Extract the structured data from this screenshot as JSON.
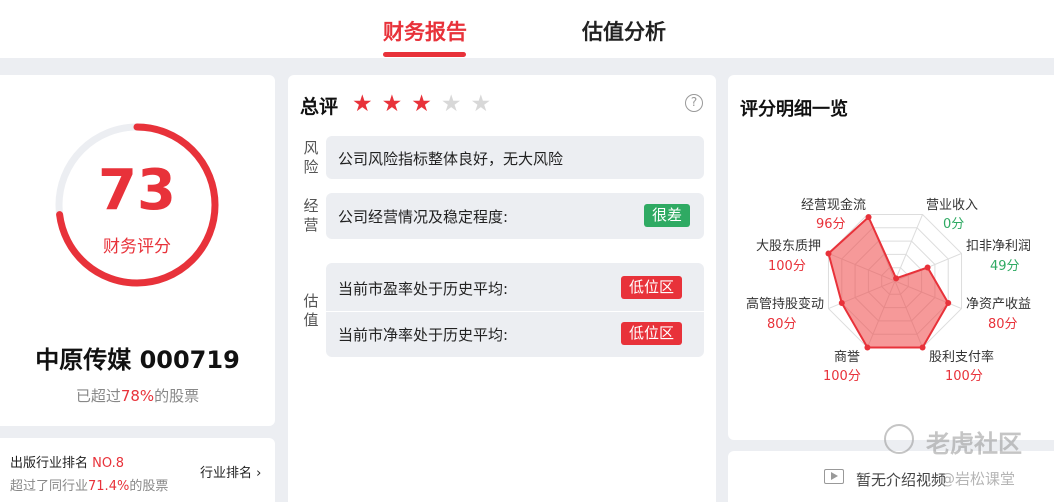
{
  "tabs": {
    "financial_report": "财务报告",
    "valuation": "估值分析"
  },
  "score": {
    "value": 73,
    "max": 100,
    "label": "财务评分"
  },
  "stock": {
    "name": "中原传媒 000719",
    "exceed_prefix": "已超过",
    "exceed_pct": "78%",
    "exceed_suffix": "的股票"
  },
  "industry_rank": {
    "prefix": "出版行业排名 ",
    "rank": "NO.8",
    "exceed_prefix": "超过了同行业",
    "exceed_pct": "71.4%",
    "exceed_suffix": "的股票",
    "link_label": "行业排名",
    "link_chevron": "›"
  },
  "summary": {
    "title": "总评",
    "stars_total": 5,
    "stars_filled": 3,
    "help": "?",
    "risk": {
      "label": "风险",
      "text": "公司风险指标整体良好，无大风险"
    },
    "operation": {
      "label": "经营",
      "text": "公司经营情况及稳定程度:",
      "badge": "很差",
      "badge_color": "#2faa63"
    },
    "valuation": {
      "label": "估值",
      "pe_text": "当前市盈率处于历史平均:",
      "pe_badge": "低位区",
      "pb_text": "当前市净率处于历史平均:",
      "pb_badge": "低位区",
      "badge_color": "#e8323a"
    }
  },
  "detail": {
    "title": "评分明细一览",
    "no_intro": "暂无介绍视频"
  },
  "chart_data": {
    "type": "radar",
    "max": 100,
    "axes": [
      {
        "label": "营业收入",
        "value": 0,
        "display": "0分",
        "color": "green"
      },
      {
        "label": "扣非净利润",
        "value": 49,
        "display": "49分",
        "color": "green"
      },
      {
        "label": "净资产收益",
        "value": 80,
        "display": "80分",
        "color": "red"
      },
      {
        "label": "股利支付率",
        "value": 100,
        "display": "100分",
        "color": "red"
      },
      {
        "label": "商誉",
        "value": 100,
        "display": "100分",
        "color": "red"
      },
      {
        "label": "高管持股变动",
        "value": 80,
        "display": "80分",
        "color": "red"
      },
      {
        "label": "大股东质押",
        "value": 100,
        "display": "100分",
        "color": "red"
      },
      {
        "label": "经营现金流",
        "value": 96,
        "display": "96分",
        "color": "red"
      }
    ]
  },
  "watermark": {
    "brand": "老虎社区",
    "author": "@岩松课堂"
  },
  "colors": {
    "accent": "#e8323a",
    "positive": "#2faa63",
    "background": "#eceef2"
  }
}
